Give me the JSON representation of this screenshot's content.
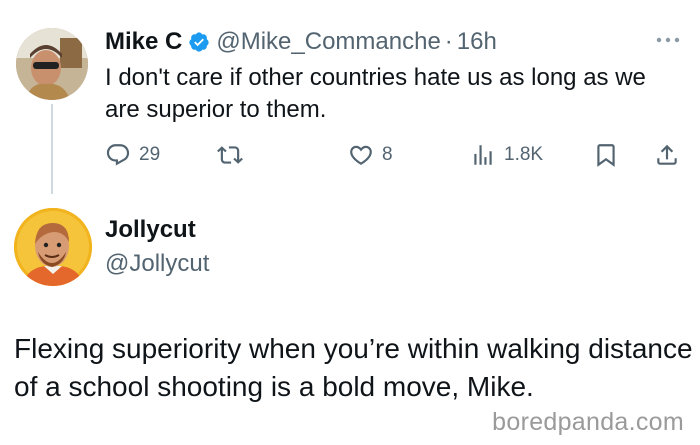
{
  "tweet": {
    "author_name": "Mike C",
    "author_handle": "@Mike_Commanche",
    "separator": "·",
    "time_ago": "16h",
    "text": "I don't care if other countries hate us as long as we are superior to them.",
    "verified": true,
    "stats": {
      "replies": "29",
      "likes": "8",
      "views": "1.8K"
    },
    "icons": [
      "reply-icon",
      "retweet-icon",
      "like-icon",
      "views-icon",
      "bookmark-icon",
      "share-icon",
      "more-icon",
      "verified-badge-icon"
    ]
  },
  "reply": {
    "author_name": "Jollycut",
    "author_handle": "@Jollycut",
    "text": "Flexing superiority when you’re within walking distance of a school shooting is a bold move, Mike."
  },
  "watermark": "boredpanda.com",
  "colors": {
    "text": "#0f1419",
    "secondary": "#536471",
    "verified": "#1d9bf0",
    "watermark": "#9a9a9a"
  }
}
